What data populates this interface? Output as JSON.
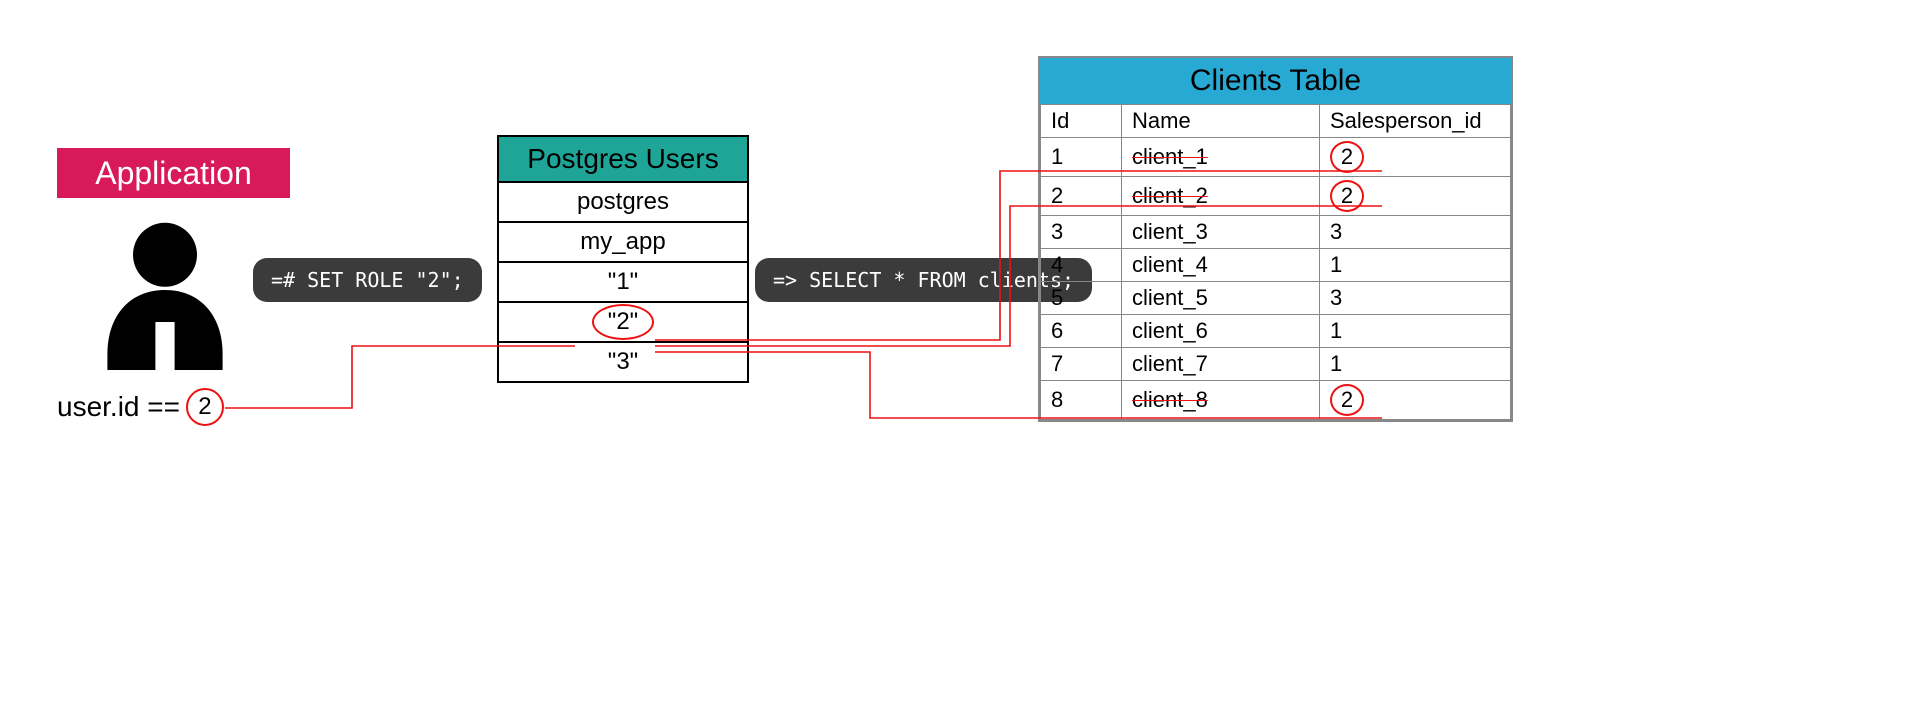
{
  "application": {
    "title": "Application",
    "user_id_label": "user.id ==",
    "user_id_value": "2"
  },
  "sql": {
    "set_role": "=# SET ROLE \"2\";",
    "select": "=> SELECT * FROM clients;"
  },
  "pg_users": {
    "title": "Postgres Users",
    "rows": [
      "postgres",
      "my_app",
      "\"1\"",
      "\"2\"",
      "\"3\""
    ],
    "highlight_index": 3
  },
  "clients": {
    "title": "Clients Table",
    "columns": [
      "Id",
      "Name",
      "Salesperson_id"
    ],
    "rows": [
      {
        "id": "1",
        "name": "client_1",
        "sid": "2",
        "hl": true
      },
      {
        "id": "2",
        "name": "client_2",
        "sid": "2",
        "hl": true
      },
      {
        "id": "3",
        "name": "client_3",
        "sid": "3",
        "hl": false
      },
      {
        "id": "4",
        "name": "client_4",
        "sid": "1",
        "hl": false
      },
      {
        "id": "5",
        "name": "client_5",
        "sid": "3",
        "hl": false
      },
      {
        "id": "6",
        "name": "client_6",
        "sid": "1",
        "hl": false
      },
      {
        "id": "7",
        "name": "client_7",
        "sid": "1",
        "hl": false
      },
      {
        "id": "8",
        "name": "client_8",
        "sid": "2",
        "hl": true
      }
    ]
  }
}
